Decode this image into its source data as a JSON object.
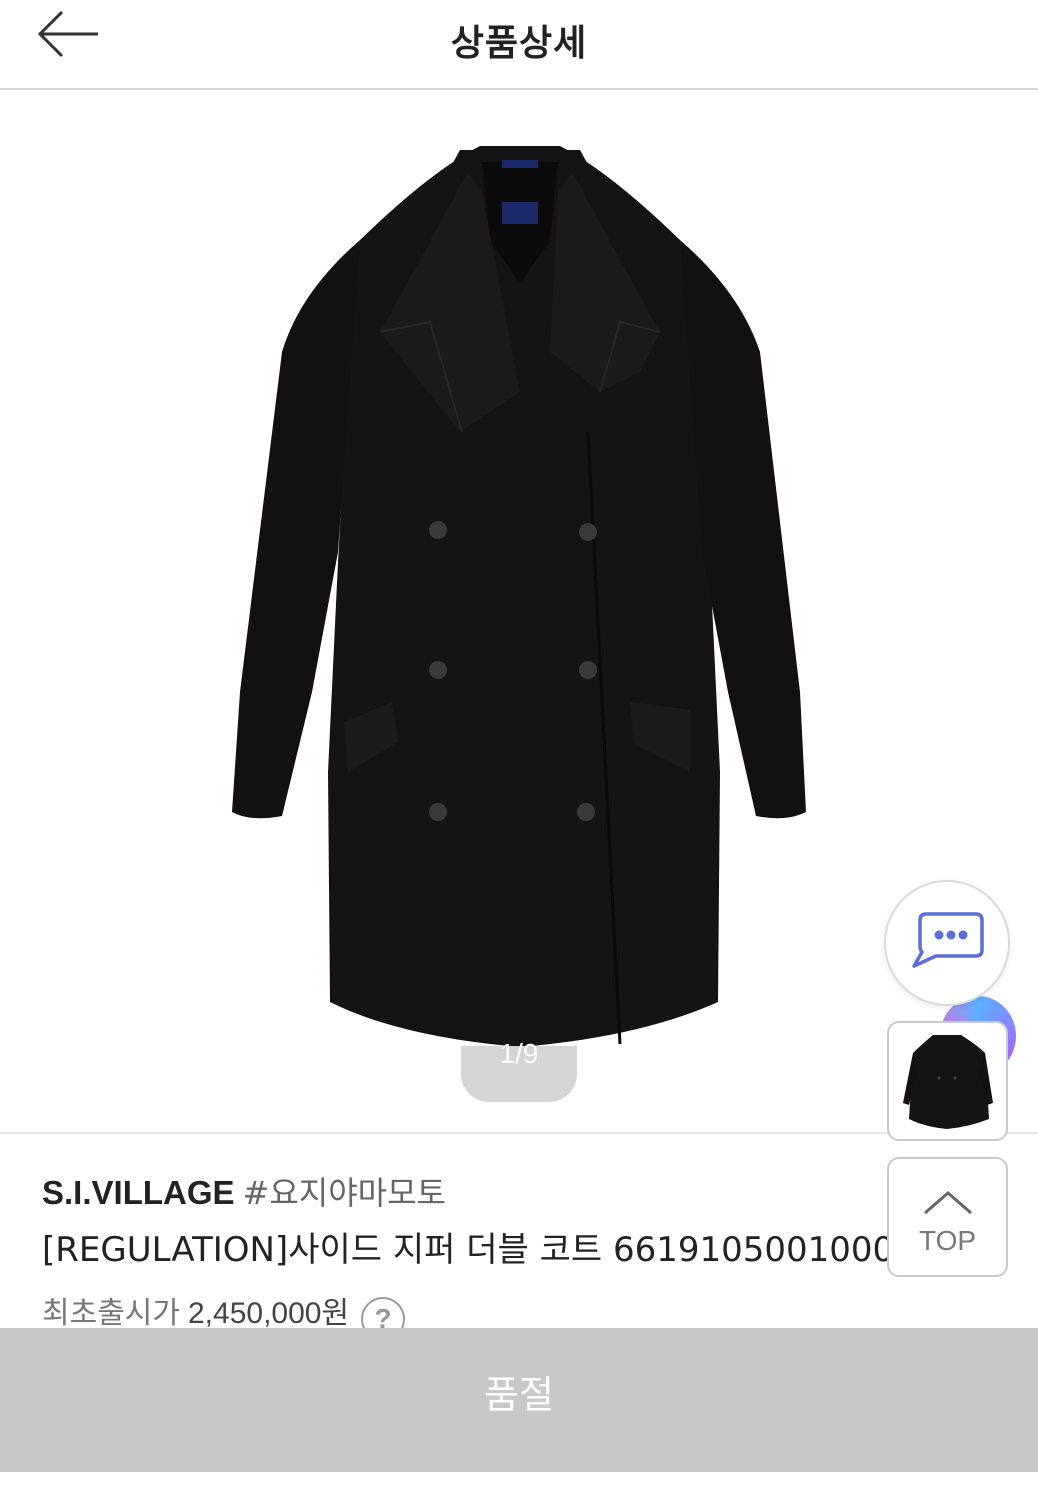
{
  "header": {
    "title": "상품상세",
    "back_icon": "arrow-left-icon"
  },
  "gallery": {
    "indicator": "1/9",
    "image_alt": "black double-breasted coat"
  },
  "product": {
    "brand": "S.I.VILLAGE",
    "brand_tag": "#요지야마모토",
    "name": "[REGULATION]사이드 지퍼 더블 코트 6619105001000",
    "price_label": "최초출시가",
    "price_value": "2,450,000원",
    "help_label": "?"
  },
  "floating": {
    "chat_icon": "chat-bubble-icon",
    "top_label": "TOP",
    "top_icon": "chevron-up-icon"
  },
  "cta": {
    "label": "품절"
  },
  "colors": {
    "soldout_bg": "#c8c8c8",
    "chat_icon": "#5a6fd8"
  }
}
